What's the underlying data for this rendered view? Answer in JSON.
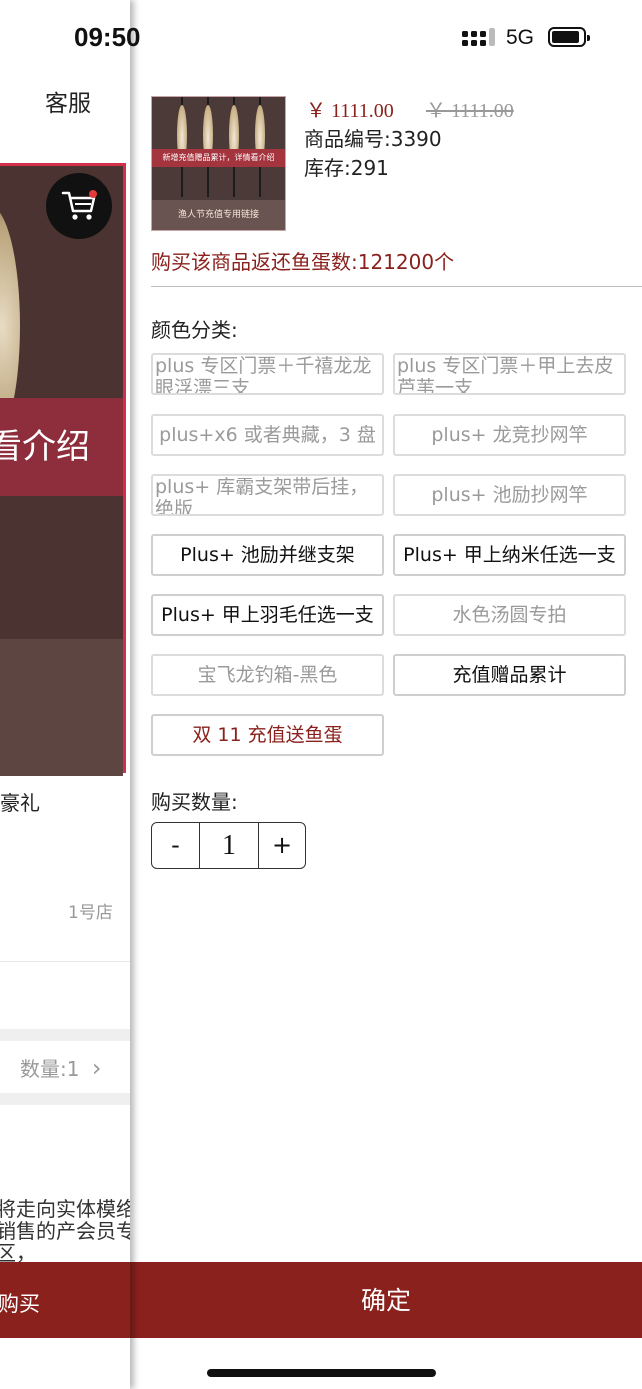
{
  "status_bar": {
    "time": "09:50",
    "network": "5G"
  },
  "background_page": {
    "service_label": "客服",
    "banner_text": "看介绍",
    "product_title_fragment": "豪礼",
    "shop_name": "1号店",
    "quantity_text": "数量:1",
    "chevron": "›",
    "description_fragment": "将走向实体模络销售的产会员专区，",
    "buy_label": "购买"
  },
  "product": {
    "thumbnail_banner": "新增充值赠品累计，详情看介绍",
    "thumbnail_caption": "渔人节充值专用链接",
    "price": "￥ 1111.00",
    "original_price": "￥ 1111.00",
    "sku": "商品编号:3390",
    "stock": "库存:291",
    "rebate": "购买该商品返还鱼蛋数:121200个"
  },
  "options": {
    "label": "颜色分类:",
    "items": [
      {
        "label": "plus 专区门票＋千禧龙龙眼浮漂三支",
        "state": "disabled"
      },
      {
        "label": "plus 专区门票＋甲上去皮芦苇一支",
        "state": "disabled"
      },
      {
        "label": "plus+x6 或者典藏，3 盘",
        "state": "disabled"
      },
      {
        "label": "plus+ 龙竞抄网竿",
        "state": "disabled"
      },
      {
        "label": "plus+ 库霸支架带后挂，绝版",
        "state": "disabled"
      },
      {
        "label": "plus+ 池励抄网竿",
        "state": "disabled"
      },
      {
        "label": "Plus+ 池励并继支架",
        "state": "available"
      },
      {
        "label": "Plus+ 甲上纳米任选一支",
        "state": "available"
      },
      {
        "label": "Plus+ 甲上羽毛任选一支",
        "state": "available"
      },
      {
        "label": "水色汤圆专拍",
        "state": "disabled"
      },
      {
        "label": "宝飞龙钓箱-黑色",
        "state": "disabled"
      },
      {
        "label": "充值赠品累计",
        "state": "available"
      },
      {
        "label": "双 11 充值送鱼蛋",
        "state": "selected"
      }
    ]
  },
  "quantity": {
    "label": "购买数量:",
    "value": "1",
    "minus": "-",
    "plus": "+"
  },
  "confirm_label": "确定",
  "colors": {
    "accent": "#8a211d",
    "disabled_text": "#9a9a9a",
    "banner_border": "#d23048"
  }
}
